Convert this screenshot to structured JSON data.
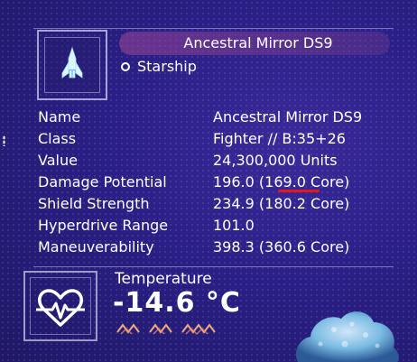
{
  "header": {
    "title": "Ancestral Mirror DS9",
    "type": "Starship"
  },
  "stats": [
    {
      "label": "Name",
      "value": "Ancestral Mirror DS9"
    },
    {
      "label": "Class",
      "value": "Fighter // B:35+26"
    },
    {
      "label": "Value",
      "value": "24,300,000 Units"
    },
    {
      "label": "Damage Potential",
      "value": "196.0  (169.0 Core)"
    },
    {
      "label": "Shield Strength",
      "value": "234.9  (180.2 Core)"
    },
    {
      "label": "Hyperdrive Range",
      "value": "101.0"
    },
    {
      "label": "Maneuverability",
      "value": "398.3  (360.6 Core)"
    }
  ],
  "temperature": {
    "label": "Temperature",
    "value": "-14.6 °C"
  },
  "colors": {
    "background": "#2a1f86",
    "title_banner": "#a04696",
    "annotation": "#e8141e",
    "hazard_zigzag": "#f0a880"
  },
  "icons": [
    "starship-icon",
    "bullet-ring-icon",
    "heart-rate-icon",
    "hazard-zigzag-icon"
  ]
}
